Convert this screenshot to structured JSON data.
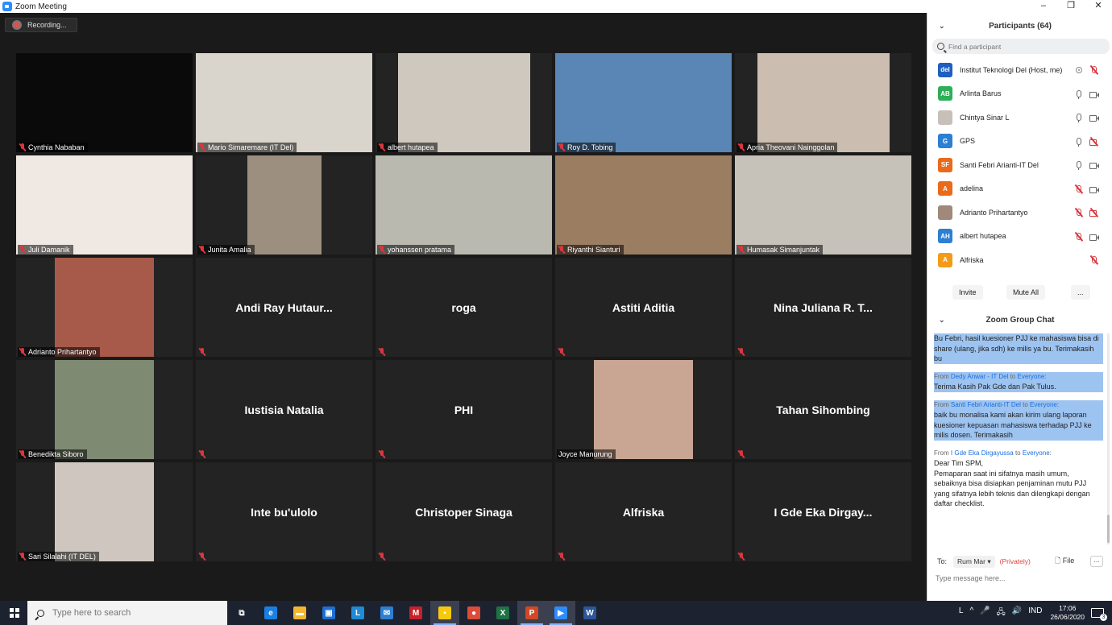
{
  "window": {
    "title": "Zoom Meeting",
    "controls": [
      "–",
      "❐",
      "✕"
    ]
  },
  "meeting": {
    "recording_label": "Recording...",
    "tiles": [
      {
        "name": "Cynthia Nababan",
        "video": true,
        "bg": "#0a0a0a",
        "photo_w": 219
      },
      {
        "name": "Mario Simaremare (IT Del)",
        "video": true,
        "bg": "#d9d4cc",
        "photo_w": 219
      },
      {
        "name": "albert hutapea",
        "video": true,
        "bg": "#cfc8bf",
        "photo_w": 164
      },
      {
        "name": "Roy D. Tobing",
        "video": true,
        "bg": "#5a86b5",
        "photo_w": 219
      },
      {
        "name": "Apria Theovani Nainggolan",
        "video": true,
        "bg": "#cbbdb0",
        "photo_w": 164
      },
      {
        "name": "Juli Damanik",
        "video": true,
        "bg": "#efe8e3",
        "photo_w": 219
      },
      {
        "name": "Junita Amalia",
        "video": true,
        "bg": "#9d8f80",
        "photo_w": 92
      },
      {
        "name": "yohanssen pratama",
        "video": true,
        "bg": "#b9b9b0",
        "photo_w": 219
      },
      {
        "name": "Riyanthi Sianturi",
        "video": true,
        "bg": "#9b7d62",
        "photo_w": 219
      },
      {
        "name": "Humasak Simanjuntak",
        "video": true,
        "bg": "#c7c2b9",
        "photo_w": 219
      },
      {
        "name": "Adrianto Prihartantyo",
        "video": true,
        "bg": "#a85a4a",
        "photo_w": 123
      },
      {
        "name": "Andi Ray Hutaur...",
        "video": false
      },
      {
        "name": "roga",
        "video": false
      },
      {
        "name": "Astiti Aditia",
        "video": false
      },
      {
        "name": "Nina Juliana R. T...",
        "video": false
      },
      {
        "name": "Benedikta Siboro",
        "video": true,
        "bg": "#7f8a72",
        "photo_w": 123
      },
      {
        "name": "Iustisia Natalia",
        "video": false
      },
      {
        "name": "PHI",
        "video": false
      },
      {
        "name": "Joyce Manurung",
        "video": true,
        "bg": "#c9a593",
        "photo_w": 123,
        "mic_on": true
      },
      {
        "name": "Tahan Sihombing",
        "video": false
      },
      {
        "name": "Sari Silalahi (IT DEL)",
        "video": true,
        "bg": "#cfc7bf",
        "photo_w": 123
      },
      {
        "name": "Inte bu'ulolo",
        "video": false
      },
      {
        "name": "Christoper Sinaga",
        "video": false
      },
      {
        "name": "Alfriska",
        "video": false
      },
      {
        "name": "I Gde Eka Dirgay...",
        "video": false
      }
    ]
  },
  "participants": {
    "title": "Participants (64)",
    "search_placeholder": "Find a participant",
    "list": [
      {
        "name": "Institut Teknologi Del (Host, me)",
        "initials": "del",
        "color": "#1f5fbf",
        "icons": [
          "host-icon",
          "mic-muted-icon"
        ]
      },
      {
        "name": "Arlinta Barus",
        "initials": "AB",
        "color": "#2fae5a",
        "icons": [
          "mic-icon",
          "camera-icon"
        ]
      },
      {
        "name": "Chintya Sinar L",
        "initials": "",
        "color": "#c7c0b8",
        "icons": [
          "mic-icon",
          "camera-icon"
        ]
      },
      {
        "name": "GPS",
        "initials": "G",
        "color": "#2d7fd2",
        "icons": [
          "mic-icon",
          "camera-off-icon"
        ]
      },
      {
        "name": "Santi Febri Arianti-IT Del",
        "initials": "SF",
        "color": "#ea6a1a",
        "icons": [
          "mic-icon",
          "camera-icon"
        ]
      },
      {
        "name": "adelina",
        "initials": "A",
        "color": "#ea6a1a",
        "icons": [
          "mic-muted-icon",
          "camera-icon"
        ]
      },
      {
        "name": "Adrianto Prihartantyo",
        "initials": "",
        "color": "#a0887a",
        "icons": [
          "mic-muted-icon",
          "camera-off-icon"
        ]
      },
      {
        "name": "albert hutapea",
        "initials": "AH",
        "color": "#2d7fd2",
        "icons": [
          "mic-muted-icon",
          "camera-icon"
        ]
      },
      {
        "name": "Alfriska",
        "initials": "A",
        "color": "#f39a1a",
        "icons": [
          "mic-muted-icon"
        ]
      }
    ],
    "buttons": {
      "invite": "Invite",
      "mute_all": "Mute All",
      "more": "..."
    }
  },
  "chat": {
    "title": "Zoom Group Chat",
    "messages": [
      {
        "from": "",
        "to": "",
        "text": "Bu Febri, hasil kuesioner PJJ ke mahasiswa bisa di share (ulang, jika sdh) ke milis ya bu. Terimakasih  bu",
        "selected": true
      },
      {
        "from": "Dedy Anwar - IT Del",
        "to": "Everyone",
        "text": "Terima Kasih Pak Gde dan Pak Tulus.",
        "selected": true
      },
      {
        "from": "Santi Febri Arianti-IT Del",
        "to": "Everyone",
        "text": "baik bu monalisa kami akan kirim ulang laporan kuesioner kepuasan mahasiswa terhadap PJJ ke milis dosen. Terimakasih",
        "selected": true
      },
      {
        "from": "I Gde Eka Dirgayussa",
        "to": "Everyone",
        "text": "Dear Tim SPM,\nPemaparan saat ini sifatnya masih umum, sebaiknya bisa disiapkan penjaminan mutu PJJ yang sifatnya lebih teknis dan dilengkapi dengan daftar checklist.",
        "selected": false
      }
    ],
    "from_label": "From",
    "to_label": "to",
    "to_prefix": "To:",
    "recipient": "Rum Mar",
    "privately": "(Privately)",
    "file_label": "File",
    "more_label": "...",
    "input_placeholder": "Type message here..."
  },
  "taskbar": {
    "search_placeholder": "Type here to search",
    "apps": [
      {
        "name": "task-view-icon",
        "glyph": "⧉",
        "color": "transparent",
        "active": false
      },
      {
        "name": "edge-icon",
        "glyph": "e",
        "color": "#1b7fe0",
        "active": false
      },
      {
        "name": "file-explorer-icon",
        "glyph": "▬",
        "color": "#f2b630",
        "active": false
      },
      {
        "name": "store-icon",
        "glyph": "▣",
        "color": "#1b6fd0",
        "active": false
      },
      {
        "name": "l-app-icon",
        "glyph": "L",
        "color": "#1f8ad6",
        "active": false
      },
      {
        "name": "mail-icon",
        "glyph": "✉",
        "color": "#2d7fd2",
        "active": false
      },
      {
        "name": "mcafee-icon",
        "glyph": "M",
        "color": "#c8202a",
        "active": false
      },
      {
        "name": "sticky-notes-icon",
        "glyph": "▪",
        "color": "#f6c90e",
        "active": true
      },
      {
        "name": "chrome-icon",
        "glyph": "●",
        "color": "#dd4b39",
        "active": false
      },
      {
        "name": "excel-icon",
        "glyph": "X",
        "color": "#1f7244",
        "active": false
      },
      {
        "name": "powerpoint-icon",
        "glyph": "P",
        "color": "#d24726",
        "active": true
      },
      {
        "name": "zoom-icon",
        "glyph": "▶",
        "color": "#2d8cff",
        "active": true
      },
      {
        "name": "word-icon",
        "glyph": "W",
        "color": "#2b579a",
        "active": false
      }
    ],
    "tray": [
      "L",
      "^",
      "🎤",
      "🖧",
      "🔊",
      "IND"
    ],
    "time": "17:06",
    "date": "26/06/2020",
    "notif_count": "3"
  }
}
